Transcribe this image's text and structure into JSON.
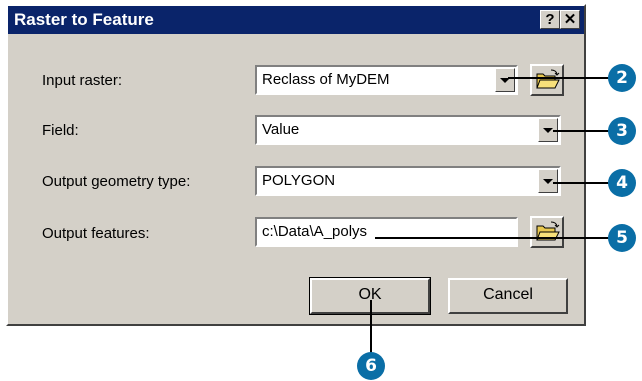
{
  "dialog": {
    "title": "Raster to Feature",
    "help_label": "?",
    "close_label": "✕"
  },
  "fields": {
    "input_raster": {
      "label": "Input raster:",
      "value": "Reclass of MyDEM"
    },
    "field": {
      "label": "Field:",
      "value": "Value"
    },
    "geometry_type": {
      "label": "Output geometry type:",
      "value": "POLYGON"
    },
    "output_features": {
      "label": "Output features:",
      "value": "c:\\Data\\A_polys"
    }
  },
  "buttons": {
    "ok": "OK",
    "cancel": "Cancel"
  },
  "callouts": {
    "c2": "2",
    "c3": "3",
    "c4": "4",
    "c5": "5",
    "c6": "6"
  },
  "icons": {
    "browse": "folder-open-icon",
    "dropdown": "chevron-down-icon"
  },
  "colors": {
    "titlebar": "#0a246a",
    "dialog_face": "#d4d0c8",
    "callout": "#0a6ea6"
  }
}
